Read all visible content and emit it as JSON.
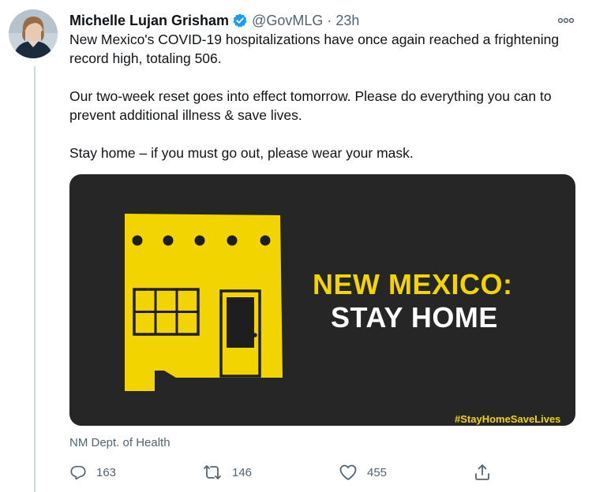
{
  "tweet": {
    "author": {
      "display_name": "Michelle Lujan Grisham",
      "handle": "@GovMLG",
      "verified": true,
      "avatar_icon": "avatar-portrait"
    },
    "separator": "·",
    "time": "23h",
    "more_icon": "more-options-icon",
    "paragraphs": [
      "New Mexico's COVID-19 hospitalizations have once again reached a frightening record high, totaling 506.",
      "Our two-week reset goes into effect tomorrow. Please do everything you can to prevent additional illness & save lives.",
      "Stay home – if you must go out, please wear your mask."
    ],
    "media": {
      "headline_line1": "NEW MEXICO:",
      "headline_line2": "STAY HOME",
      "hashtag": "#StayHomeSaveLives",
      "colors": {
        "background": "#262626",
        "accent": "#f2d500",
        "text": "#ffffff"
      }
    },
    "source": "NM Dept. of Health",
    "actions": {
      "reply": {
        "icon": "reply-icon",
        "count": "163"
      },
      "retweet": {
        "icon": "retweet-icon",
        "count": "146"
      },
      "like": {
        "icon": "heart-icon",
        "count": "455"
      },
      "share": {
        "icon": "share-icon"
      }
    },
    "colors": {
      "verified_badge": "#1d9bf0",
      "secondary_text": "#536471",
      "primary_text": "#0f1419"
    }
  }
}
